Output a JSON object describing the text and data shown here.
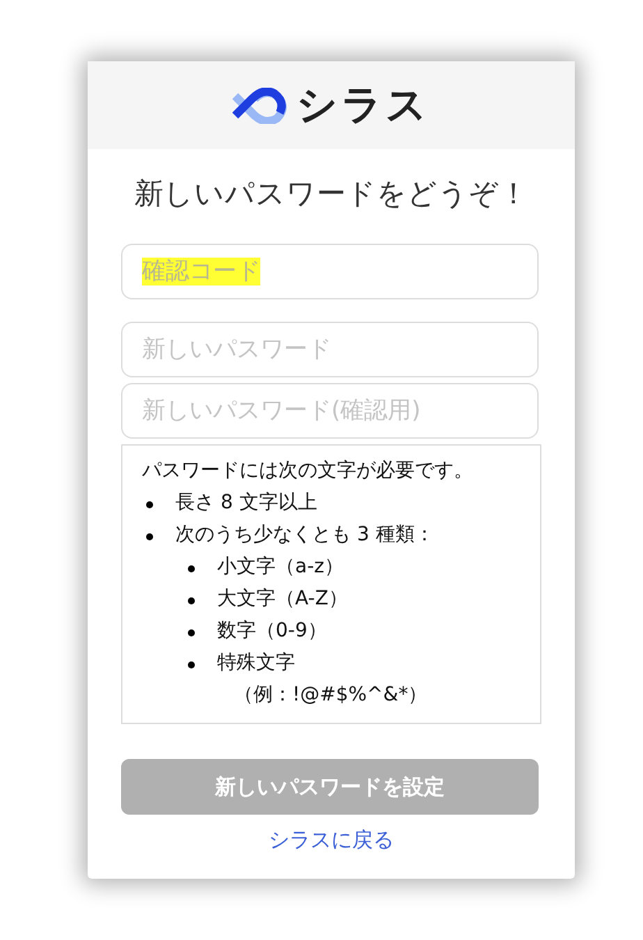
{
  "logo": {
    "text": "シラス"
  },
  "title": "新しいパスワードをどうぞ！",
  "fields": [
    {
      "placeholder": "確認コード",
      "highlighted": true
    },
    {
      "placeholder": "新しいパスワード",
      "highlighted": false
    },
    {
      "placeholder": "新しいパスワード(確認用)",
      "highlighted": false
    }
  ],
  "requirements": {
    "intro": "パスワードには次の文字が必要です。",
    "items": [
      {
        "text": "長さ 8 文字以上"
      },
      {
        "text": "次のうち少なくとも 3 種類：",
        "children": [
          {
            "text": "小文字（a-z）"
          },
          {
            "text": "大文字（A-Z）"
          },
          {
            "text": "数字（0-9）"
          },
          {
            "text": "特殊文字",
            "note": "（例：!@#$%^&*）"
          }
        ]
      }
    ]
  },
  "submit_button": {
    "label": "新しいパスワードを設定",
    "disabled": true
  },
  "back_link": "シラスに戻る"
}
